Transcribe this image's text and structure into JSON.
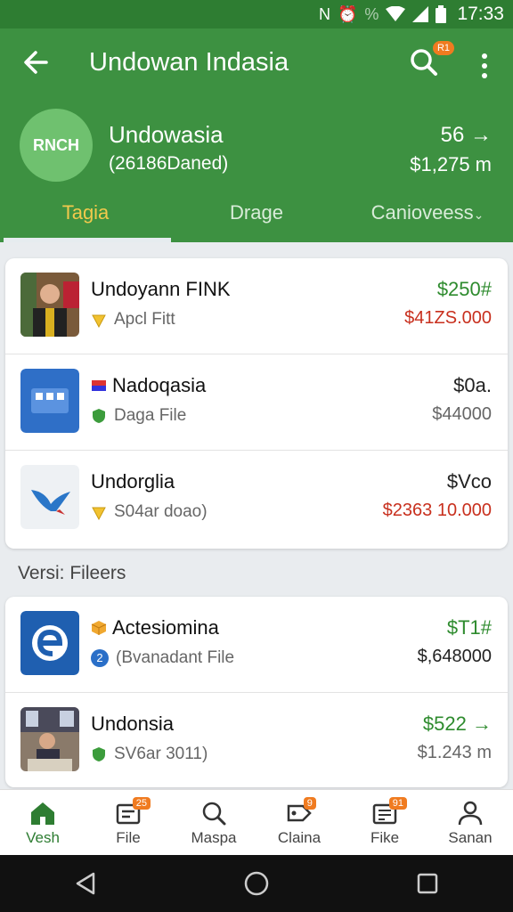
{
  "status_bar": {
    "time": "17:33"
  },
  "header": {
    "title": "Undowan Indasia",
    "search_badge": "R1",
    "account": {
      "avatar_text": "RNCH",
      "name": "Undowasia",
      "sub": "(26186Daned)",
      "count": "56",
      "amount": "$1,275 m"
    },
    "tabs": [
      {
        "label": "Tagia"
      },
      {
        "label": "Drage"
      },
      {
        "label": "Canioveess"
      }
    ]
  },
  "list1": [
    {
      "title": "Undoyann FINK",
      "sub": "Apcl Fitt",
      "price": "$250#",
      "amount": "$41ZS.000"
    },
    {
      "title": "Nadoqasia",
      "sub": "Daga File",
      "price": "$0a.",
      "amount": "$44000"
    },
    {
      "title": "Undorglia",
      "sub": "S04ar doao)",
      "price": "$Vco",
      "amount": "$2363 10.000"
    }
  ],
  "section_label": "Versi: Fileers",
  "list2": [
    {
      "title": "Actesiomina",
      "sub": "(Bvanadant File",
      "sub_badge": "2",
      "price": "$T1#",
      "amount": "$,648000"
    },
    {
      "title": "Undonsia",
      "sub": "SV6ar 3011)",
      "price": "$522",
      "amount": "$1.243 m"
    }
  ],
  "bottom_nav": [
    {
      "label": "Vesh"
    },
    {
      "label": "File",
      "badge": "25"
    },
    {
      "label": "Maspa"
    },
    {
      "label": "Claina",
      "badge": "9"
    },
    {
      "label": "Fike",
      "badge": "91"
    },
    {
      "label": "Sanan"
    }
  ],
  "colors": {
    "primary": "#3d9141",
    "status_bar": "#2e7d32",
    "accent": "#f2c94c",
    "badge": "#f07b20",
    "price_green": "#2e8b2e",
    "price_red": "#c8301e"
  }
}
